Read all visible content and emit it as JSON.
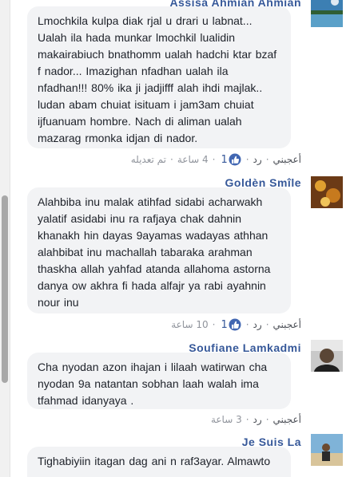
{
  "comments": [
    {
      "author": "Assisa Ahmian Ahmian",
      "text": "Lmochkila kulpa diak rjal u drari u labnat...\nUalah ila hada munkar lmochkil lualidin\nmakairabiuch bnathomm ualah hadchi ktar bzaf\nf nador... Imazighan nfadhan ualah ila\nnfadhan!!! 80% ika ji jadjifff alah ihdi majlak..\nludan abam chuiat isituam i jam3am chuiat\nijfuanuam hombre. Nach di aliman ualah\nmazarag rmonka idjan di nador.",
      "like_label": "أعجبني",
      "reply_label": "رد",
      "like_count": "1",
      "time": "4 ساعة",
      "edited_label": "تم تعديله",
      "avatar_icon": "profile-photo"
    },
    {
      "author": "Goldèn Smîle",
      "text": "Alahbiba inu malak atihfad sidabi acharwakh\nyalatif asidabi inu ra rafjaya chak dahnin\nkhanakh hin dayas 9ayamas wadayas athhan\nalahbibat inu machallah tabaraka arahman\nthaskha allah yahfad atanda allahoma astorna\ndanya ow akhra fi hada alfajr ya rabi ayahnin\nnour inu",
      "like_label": "أعجبني",
      "reply_label": "رد",
      "like_count": "1",
      "time": "10 ساعة",
      "avatar_icon": "profile-photo"
    },
    {
      "author": "Soufiane Lamkadmi",
      "text": "Cha nyodan azon ihajan i lilaah watirwan cha\nnyodan 9a natantan sobhan laah walah ima\ntfahmad idanyaya .",
      "like_label": "أعجبني",
      "reply_label": "رد",
      "time": "3 ساعة",
      "avatar_icon": "profile-photo"
    },
    {
      "author": "Je Suis La",
      "text": "Tighabiyiin itagan dag ani n raf3ayar. Almawto",
      "avatar_icon": "profile-photo"
    }
  ],
  "colors": {
    "author": "#365899",
    "bubble": "#f2f3f5",
    "meta": "#90949c",
    "like_blue": "#4267b2"
  }
}
